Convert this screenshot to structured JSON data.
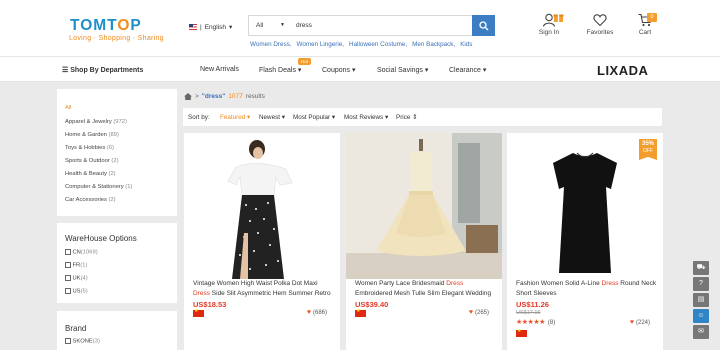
{
  "header": {
    "logo_text": "TOMTOP",
    "tagline": "Loving · Shopping · Sharing",
    "language": "English",
    "search_category": "All",
    "search_query": "dress",
    "hot_keywords": [
      "Women Dress,",
      "Women Lingerie,",
      "Halloween Costume,",
      "Men Backpack,",
      "Kids"
    ],
    "signin_label": "Sign In",
    "favorites_label": "Favorites",
    "cart_label": "Cart",
    "cart_count": "0"
  },
  "nav": {
    "departments": "Shop By Departments",
    "new_arrivals": "New Arrivals",
    "flash_deals": "Flash Deals",
    "flash_badge": "Hot",
    "coupons": "Coupons",
    "social_savings": "Social Savings",
    "clearance": "Clearance",
    "brand": "LIXADA"
  },
  "categories": [
    {
      "label": "All",
      "count": ""
    },
    {
      "label": "Apparel & Jewelry",
      "count": "(972)"
    },
    {
      "label": "Home & Garden",
      "count": "(89)"
    },
    {
      "label": "Toys & Hobbies",
      "count": "(6)"
    },
    {
      "label": "Sports & Outdoor",
      "count": "(2)"
    },
    {
      "label": "Health & Beauty",
      "count": "(2)"
    },
    {
      "label": "Computer & Stationery",
      "count": "(1)"
    },
    {
      "label": "Car Accessories",
      "count": "(2)"
    }
  ],
  "warehouse": {
    "title": "WareHouse Options",
    "options": [
      {
        "label": "CN",
        "count": "(1069)"
      },
      {
        "label": "FR",
        "count": "(1)"
      },
      {
        "label": "UK",
        "count": "(4)"
      },
      {
        "label": "US",
        "count": "(5)"
      }
    ]
  },
  "brand_filter": {
    "title": "Brand",
    "options": [
      {
        "label": "SKONE",
        "count": "(3)"
      }
    ]
  },
  "results": {
    "query_quoted": "\"dress\"",
    "count": "1077",
    "suffix": "results"
  },
  "sort": {
    "label": "Sort by:",
    "options": [
      "Featured",
      "Newest",
      "Most Popular",
      "Most Reviews",
      "Price"
    ],
    "active": "Featured"
  },
  "products": [
    {
      "title_before": "Vintage Women High Waist Polka Dot Maxi ",
      "title_hl": "Dress",
      "title_after": " Side Slit Asymmetric Hem Summer Retro",
      "price": "US$18.53",
      "likes": "(686)"
    },
    {
      "title_before": "Women Party Lace Bridesmaid ",
      "title_hl": "Dress",
      "title_after": " Embroidered Mesh Tulle Slim Elegant Wedding",
      "price": "US$39.40",
      "likes": "(265)"
    },
    {
      "title_before": "Fashion Women Solid A-Line ",
      "title_hl": "Dress",
      "title_after": " Round Neck Short Sleeves",
      "price": "US$11.26",
      "original_price": "US$17.15",
      "discount_pct": "35%",
      "discount_word": "OFF",
      "rating": 5,
      "rating_count": "(8)",
      "likes": "(224)"
    }
  ],
  "colors": {
    "brand_blue": "#1f8fc9",
    "brand_orange": "#f28c20",
    "price_red": "#e43a25",
    "search_button": "#3c7dc4"
  }
}
